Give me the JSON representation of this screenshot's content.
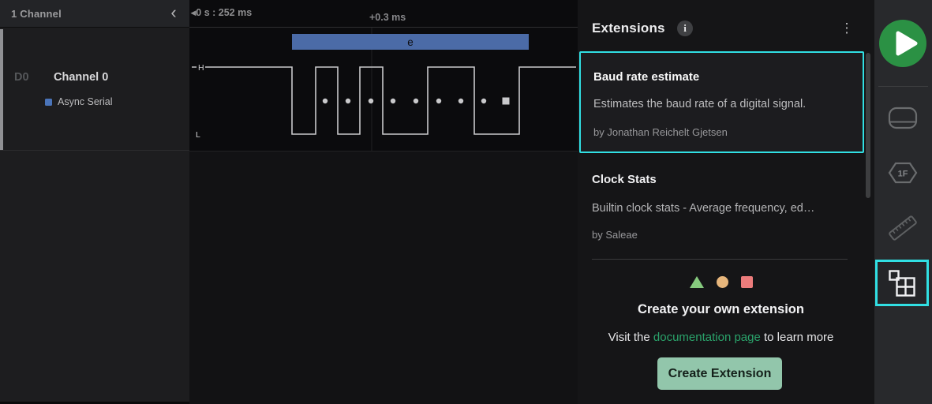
{
  "colors": {
    "accent_cyan": "#31dfe3",
    "play_green": "#2b9144",
    "link_green": "#2aa36b",
    "button_green": "#92c6ab",
    "analyzer_blue": "#4a74b9",
    "decode_bar_blue": "#4b6ba7",
    "shape_triangle_green": "#86ca7e",
    "shape_circle_orange": "#e7b67c",
    "shape_square_red": "#ec7c7c"
  },
  "sidebar": {
    "header": "1 Channel",
    "collapse_icon": "‹",
    "channel": {
      "index": "D0",
      "name": "Channel 0",
      "analyzer": "Async Serial"
    }
  },
  "timeline": {
    "range_label": "◂0 s : 252 ms",
    "offset_label": "+0.3 ms"
  },
  "waveform": {
    "high_label": "H",
    "low_label": "L",
    "decoded_byte": "e"
  },
  "extensions_panel": {
    "title": "Extensions",
    "info_icon": "i",
    "menu_icon": "⋮",
    "cards": [
      {
        "title": "Baud rate estimate",
        "description": "Estimates the baud rate of a digital signal.",
        "author": "by Jonathan Reichelt Gjetsen"
      },
      {
        "title": "Clock Stats",
        "description": "Builtin clock stats - Average frequency, ed…",
        "author": "by Saleae"
      }
    ],
    "create_section": {
      "heading": "Create your own extension",
      "visit_prefix": "Visit the ",
      "link_text": "documentation page",
      "visit_suffix": " to learn more",
      "button_label": "Create Extension"
    }
  },
  "toolbar": {
    "hexagon_label": "1F"
  }
}
